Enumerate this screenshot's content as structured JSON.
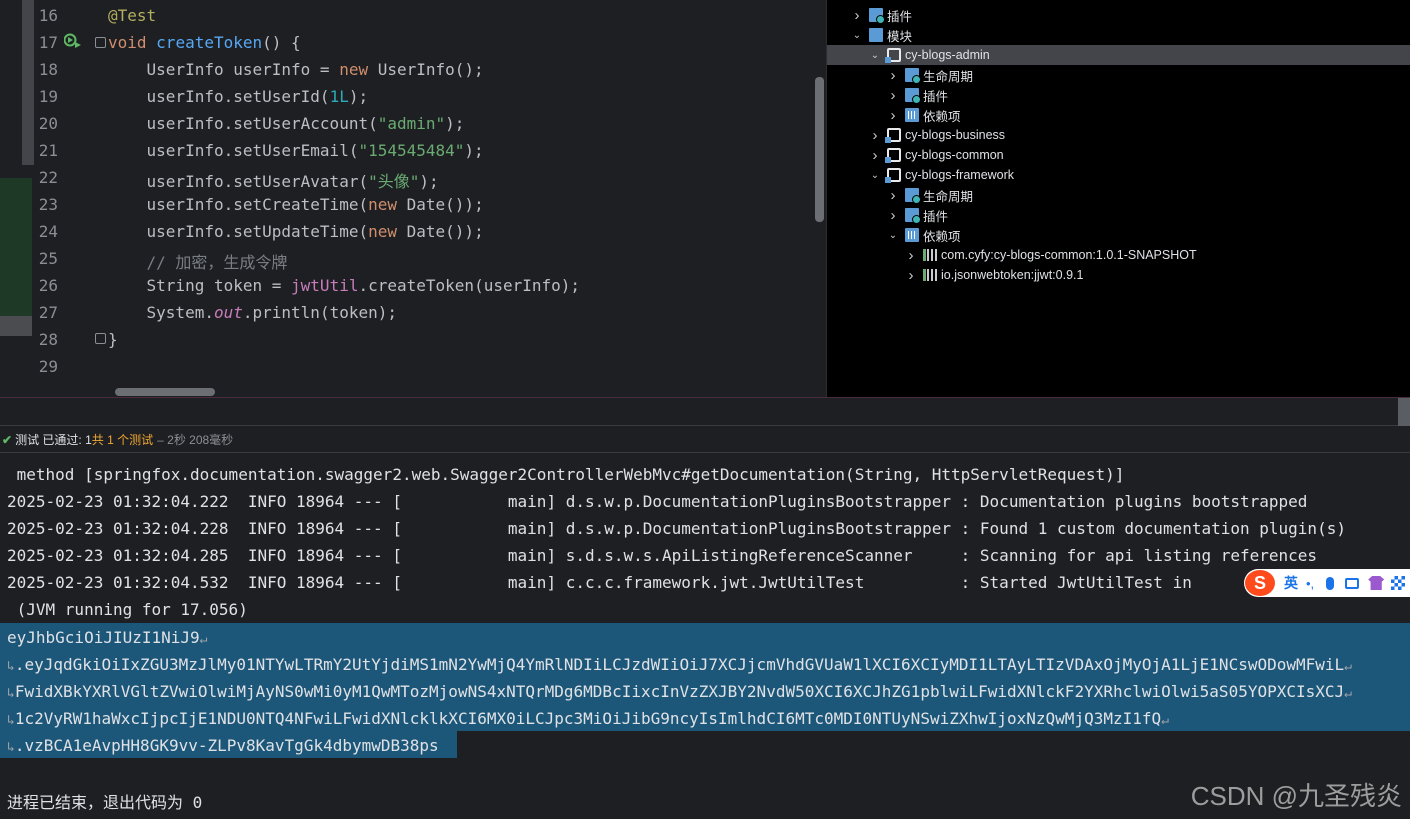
{
  "editor": {
    "line_numbers": [
      "16",
      "17",
      "18",
      "19",
      "20",
      "21",
      "22",
      "23",
      "24",
      "25",
      "26",
      "27",
      "28",
      "29"
    ],
    "annotation": "@Test",
    "kw_void": "void",
    "method_name": "createToken",
    "l17_rest": "() {",
    "l18": {
      "a": "    UserInfo userInfo = ",
      "kw": "new",
      "b": " UserInfo();"
    },
    "l19": {
      "a": "    userInfo.setUserId(",
      "num": "1L",
      "b": ");"
    },
    "l20": {
      "a": "    userInfo.setUserAccount(",
      "str": "\"admin\"",
      "b": ");"
    },
    "l21": {
      "a": "    userInfo.setUserEmail(",
      "str": "\"154545484\"",
      "b": ");"
    },
    "l22": {
      "a": "    userInfo.setUserAvatar(",
      "str": "\"头像\"",
      "b": ");"
    },
    "l23": {
      "a": "    userInfo.setCreateTime(",
      "kw": "new",
      "b": " Date());"
    },
    "l24": {
      "a": "    userInfo.setUpdateTime(",
      "kw": "new",
      "b": " Date());"
    },
    "l25": {
      "cmt": "    // 加密，生成令牌"
    },
    "l26": {
      "a": "    String token = ",
      "fld": "jwtUtil",
      "b": ".createToken(userInfo);"
    },
    "l27": {
      "a": "    System.",
      "out": "out",
      "b": ".println(token);"
    },
    "l28": "}"
  },
  "tree": {
    "rows": [
      {
        "label": "插件",
        "indent": 0,
        "expanded": false,
        "icon": "plugin-folder-icon"
      },
      {
        "label": "模块",
        "indent": 0,
        "expanded": true,
        "icon": "modules-folder-icon"
      },
      {
        "label": "cy-blogs-admin",
        "indent": 1,
        "expanded": true,
        "icon": "module-icon",
        "selected": true
      },
      {
        "label": "生命周期",
        "indent": 2,
        "expanded": false,
        "icon": "lifecycle-folder-icon"
      },
      {
        "label": "插件",
        "indent": 2,
        "expanded": false,
        "icon": "plugin-folder-icon"
      },
      {
        "label": "依赖项",
        "indent": 2,
        "expanded": false,
        "icon": "dependencies-folder-icon"
      },
      {
        "label": "cy-blogs-business",
        "indent": 1,
        "expanded": false,
        "icon": "module-icon"
      },
      {
        "label": "cy-blogs-common",
        "indent": 1,
        "expanded": false,
        "icon": "module-icon"
      },
      {
        "label": "cy-blogs-framework",
        "indent": 1,
        "expanded": true,
        "icon": "module-icon"
      },
      {
        "label": "生命周期",
        "indent": 2,
        "expanded": false,
        "icon": "lifecycle-folder-icon"
      },
      {
        "label": "插件",
        "indent": 2,
        "expanded": false,
        "icon": "plugin-folder-icon"
      },
      {
        "label": "依赖项",
        "indent": 2,
        "expanded": true,
        "icon": "dependencies-folder-icon"
      },
      {
        "label": "com.cyfy:cy-blogs-common:1.0.1-SNAPSHOT",
        "indent": 3,
        "expanded": false,
        "icon": "library-icon"
      },
      {
        "label": "io.jsonwebtoken:jjwt:0.9.1",
        "indent": 3,
        "expanded": false,
        "icon": "library-icon"
      }
    ]
  },
  "status": {
    "check_mark": "✔",
    "label": "测试",
    "passed": "已通过:",
    "passed_count": "1",
    "total": "共 1 个测试",
    "duration": "– 2秒 208毫秒"
  },
  "console": {
    "lines": [
      " method [springfox.documentation.swagger2.web.Swagger2ControllerWebMvc#getDocumentation(String, HttpServletRequest)]",
      "2025-02-23 01:32:04.222  INFO 18964 --- [           main] d.s.w.p.DocumentationPluginsBootstrapper : Documentation plugins bootstrapped",
      "2025-02-23 01:32:04.228  INFO 18964 --- [           main] d.s.w.p.DocumentationPluginsBootstrapper : Found 1 custom documentation plugin(s)",
      "2025-02-23 01:32:04.285  INFO 18964 --- [           main] s.d.s.w.s.ApiListingReferenceScanner     : Scanning for api listing references",
      "2025-02-23 01:32:04.532  INFO 18964 --- [           main] c.c.c.framework.jwt.JwtUtilTest          : Started JwtUtilTest in",
      " (JVM running for 17.056)"
    ],
    "token_lines": [
      "eyJhbGciOiJIUzI1NiJ9",
      ".eyJqdGkiOiIxZGU3MzJlMy01NTYwLTRmY2UtYjdiMS1mN2YwMjQ4YmRlNDIiLCJzdWIiOiJ7XCJjcmVhdGVUaW1lXCI6XCIyMDI1LTAyLTIzVDAxOjMyOjA1LjE1NCswODowMFwiL",
      "FwidXBkYXRlVGltZVwiOlwiMjAyNS0wMi0yM1QwMTozMjowNS4xNTQrMDg6MDBcIixcInVzZXJBY2NvdW50XCI6XCJhZG1pblwiLFwidXNlckF2YXRhclwiOlwi5aS05YOPXCIsXCJ",
      "1c2VyRW1haWxcIjpcIjE1NDU0NTQ4NFwiLFwidXNlcklkXCI6MX0iLCJpc3MiOiJibG9ncyIsImlhdCI6MTc0MDI0NTUyNSwiZXhwIjoxNzQwMjQ3MzI1fQ",
      ".vzBCA1eAvpHH8GK9vv-ZLPv8KavTgGk4dbymwDB38ps"
    ],
    "exit": "进程已结束，退出代码为 0"
  },
  "ime": {
    "logo": "S",
    "lang": "英",
    "punct": "•,"
  },
  "watermark": "CSDN @九圣残炎",
  "colors": {
    "editor_bg": "#1e1f22",
    "tree_bg": "#000000",
    "selection": "#1c5779",
    "keyword": "#cf8e6d",
    "string": "#6aab73",
    "method": "#56a8f5",
    "pass_green": "#5fb865"
  }
}
